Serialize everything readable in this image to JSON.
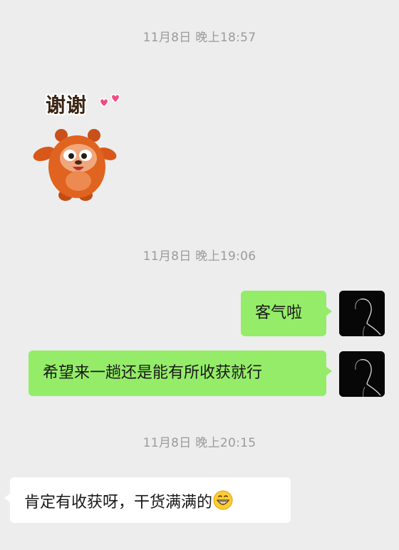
{
  "messages": [
    {
      "timestamp": "11月8日 晚上18:57",
      "sender": "other",
      "type": "sticker",
      "sticker_text": "谢谢"
    },
    {
      "timestamp": "11月8日 晚上19:06",
      "sender": "me",
      "type": "text",
      "text": "客气啦"
    },
    {
      "sender": "me",
      "type": "text",
      "text": "希望来一趟还是能有所收获就行"
    },
    {
      "timestamp": "11月8日 晚上20:15",
      "sender": "other",
      "type": "text",
      "text": "肯定有收获呀，干货满满的",
      "trailing_emoji": "grinning-face-emoji"
    }
  ],
  "colors": {
    "background": "#ededed",
    "outgoing_bubble": "#95ec69",
    "incoming_bubble": "#ffffff",
    "timestamp_text": "#9b9b9b",
    "message_text": "#191919"
  },
  "avatar": {
    "icon": "silhouette-portrait-avatar"
  }
}
